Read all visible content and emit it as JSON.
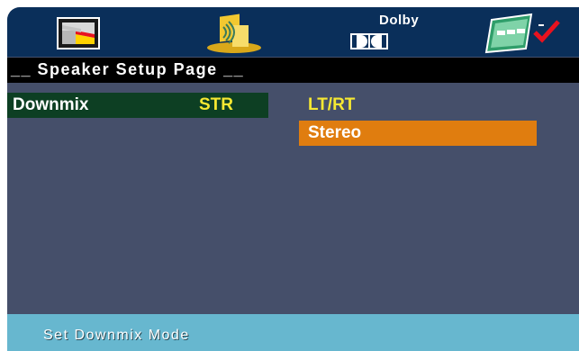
{
  "top_menu": {
    "icons": [
      {
        "name": "general-setup-icon"
      },
      {
        "name": "audio-setup-icon"
      },
      {
        "name": "dolby-digital-setup-icon",
        "label": "Dolby"
      },
      {
        "name": "preference-icon"
      }
    ],
    "dolby_label": "Dolby"
  },
  "page": {
    "title": "__ Speaker Setup Page __"
  },
  "menu": {
    "items": [
      {
        "label": "Downmix",
        "value": "STR"
      }
    ]
  },
  "options": [
    {
      "label": "LT/RT",
      "selected": false
    },
    {
      "label": "Stereo",
      "selected": true
    }
  ],
  "status": {
    "hint": "Set Downmix Mode"
  },
  "colors": {
    "screen_bg": "#454f6a",
    "top_bar": "#0a2f5a",
    "title_bar": "#000000",
    "selected_row": "#0d3f23",
    "value_text": "#f6e832",
    "highlight_option": "#e07d0f",
    "status_bar": "#67b7cf"
  }
}
